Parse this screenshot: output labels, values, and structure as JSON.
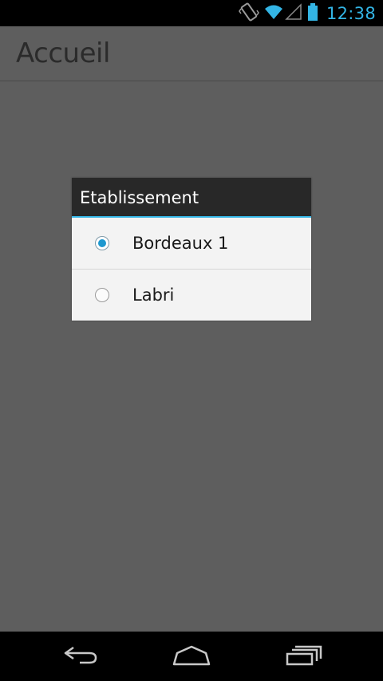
{
  "status_bar": {
    "time": "12:38",
    "icons": [
      "vibrate-icon",
      "wifi-icon",
      "signal-icon",
      "battery-icon"
    ],
    "accent_color": "#33b5e5"
  },
  "action_bar": {
    "title": "Accueil"
  },
  "dialog": {
    "title": "Etablissement",
    "options": [
      {
        "label": "Bordeaux 1",
        "selected": true
      },
      {
        "label": "Labri",
        "selected": false
      }
    ]
  },
  "nav_bar": {
    "buttons": [
      "back-icon",
      "home-icon",
      "recent-apps-icon"
    ]
  }
}
